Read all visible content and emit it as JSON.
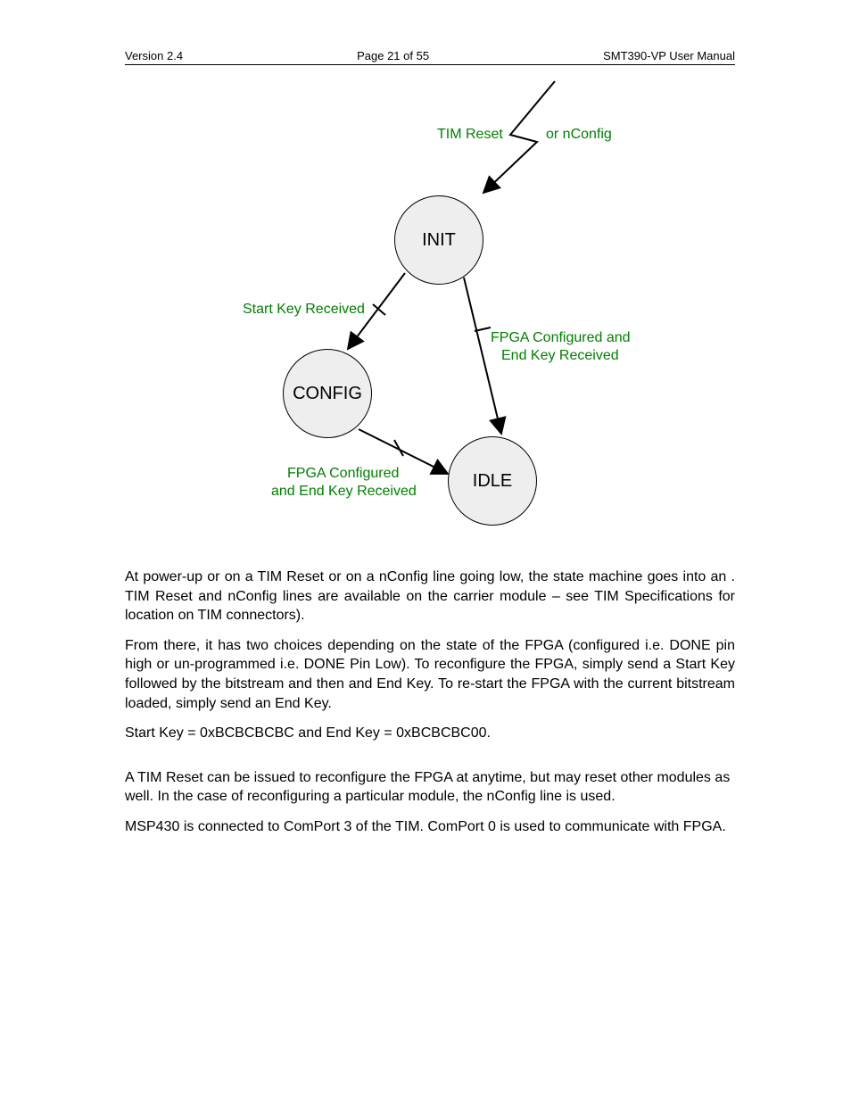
{
  "header": {
    "version": "Version 2.4",
    "page": "Page 21 of 55",
    "title": "SMT390-VP User Manual"
  },
  "diagram": {
    "states": {
      "init": "INIT",
      "config": "CONFIG",
      "idle": "IDLE"
    },
    "labels": {
      "reset_a": "TIM Reset",
      "reset_b": "or nConfig",
      "start_key": "Start Key Received",
      "fpga_end_right_a": "FPGA Configured and",
      "fpga_end_right_b": "End Key Received",
      "fpga_end_bottom_a": "FPGA Configured",
      "fpga_end_bottom_b": "and End Key Received"
    }
  },
  "body": {
    "p1": "At power-up or on a TIM Reset or on a nConfig line going low, the state machine goes into an               . TIM Reset and nConfig lines are available on the carrier module – see TIM Specifications for location on TIM connectors).",
    "p2": "From there, it has two choices depending on the state of the FPGA (configured i.e. DONE pin high or un-programmed i.e. DONE Pin Low). To reconfigure the FPGA, simply send a Start Key followed by the bitstream and then and End Key. To re-start the FPGA with the current bitstream loaded, simply send an End Key.",
    "p3": "Start Key = 0xBCBCBCBC and End Key = 0xBCBCBC00.",
    "p4": "A TIM Reset can be issued to reconfigure the FPGA at anytime, but may reset other modules as well. In the case of reconfiguring a particular module, the nConfig line is used.",
    "p5": "MSP430 is connected to ComPort 3 of the TIM. ComPort 0 is used to communicate with FPGA."
  }
}
